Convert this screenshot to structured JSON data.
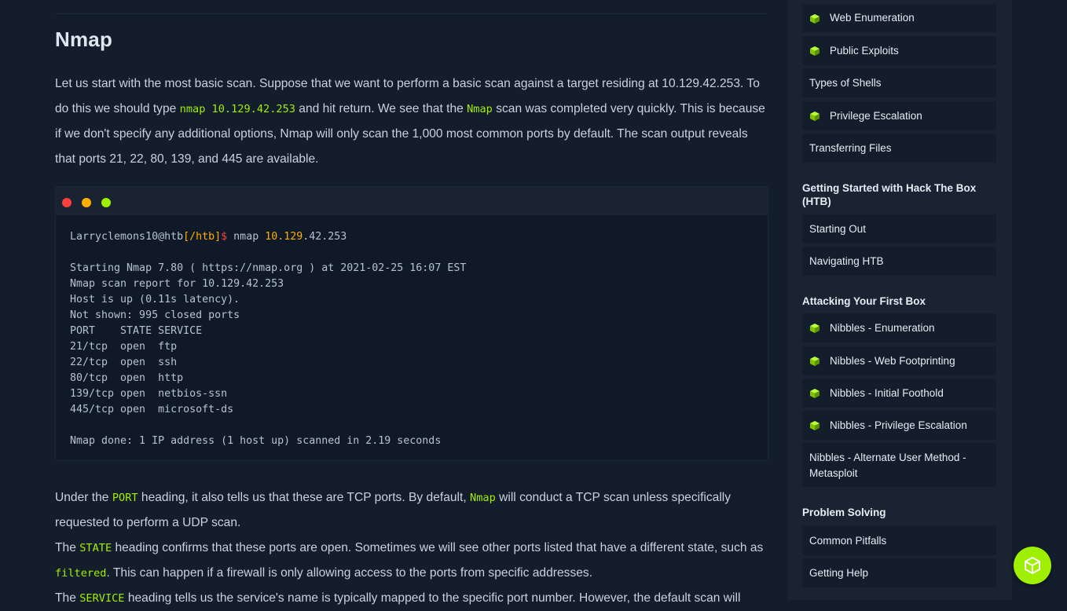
{
  "article": {
    "heading": "Nmap",
    "p1": {
      "t1": "Let us start with the most basic scan. Suppose that we want to perform a basic scan against a target residing at 10.129.42.253. To do this we should type ",
      "code1": "nmap 10.129.42.253",
      "t2": " and hit return. We see that the ",
      "code2": "Nmap",
      "t3": " scan was completed very quickly. This is because if we don't specify any additional options, Nmap will only scan the 1,000 most common ports by default. The scan output reveals that ports 21, 22, 80, 139, and 445 are available."
    },
    "terminal": {
      "prompt_user": "Larryclemons10@htb",
      "prompt_path": "[/htb]",
      "prompt_symbol": "$",
      "command_pre": " nmap ",
      "cmd_ip_a": "10.129",
      "cmd_ip_b": ".42.253",
      "output": [
        "Starting Nmap 7.80 ( https://nmap.org ) at 2021-02-25 16:07 EST",
        "Nmap scan report for 10.129.42.253",
        "Host is up (0.11s latency).",
        "Not shown: 995 closed ports",
        "PORT    STATE SERVICE",
        "21/tcp  open  ftp",
        "22/tcp  open  ssh",
        "80/tcp  open  http",
        "139/tcp open  netbios-ssn",
        "445/tcp open  microsoft-ds",
        "",
        "Nmap done: 1 IP address (1 host up) scanned in 2.19 seconds"
      ]
    },
    "p2": {
      "t1": "Under the ",
      "code1": "PORT",
      "t2": " heading, it also tells us that these are TCP ports. By default, ",
      "code2": "Nmap",
      "t3": " will conduct a TCP scan unless specifically requested to perform a UDP scan."
    },
    "p3": {
      "t1": "The ",
      "code1": "STATE",
      "t2": " heading confirms that these ports are open. Sometimes we will see other ports listed that have a different state, such as ",
      "code2": "filtered",
      "t3": ". This can happen if a firewall is only allowing access to the ports from specific addresses."
    },
    "p4": {
      "t1": "The ",
      "code1": "SERVICE",
      "t2": " heading tells us the service's name is typically mapped to the specific port number. However, the default scan will"
    }
  },
  "sidebar": {
    "items_top": [
      {
        "label": "Web Enumeration",
        "icon": "cube-icon"
      },
      {
        "label": "Public Exploits",
        "icon": "cube-icon"
      },
      {
        "label": "Types of Shells",
        "icon": ""
      },
      {
        "label": "Privilege Escalation",
        "icon": "cube-icon"
      },
      {
        "label": "Transferring Files",
        "icon": ""
      }
    ],
    "section_htb": "Getting Started with Hack The Box (HTB)",
    "items_htb": [
      {
        "label": "Starting Out"
      },
      {
        "label": "Navigating HTB"
      }
    ],
    "section_first_box": "Attacking Your First Box",
    "items_first_box": [
      {
        "label": "Nibbles - Enumeration",
        "icon": "cube-icon"
      },
      {
        "label": "Nibbles - Web Footprinting",
        "icon": "cube-icon"
      },
      {
        "label": "Nibbles - Initial Foothold",
        "icon": "cube-icon"
      },
      {
        "label": "Nibbles - Privilege Escalation",
        "icon": "cube-icon"
      },
      {
        "label": "Nibbles - Alternate User Method - Metasploit",
        "icon": ""
      }
    ],
    "section_problem": "Problem Solving",
    "items_problem": [
      {
        "label": "Common Pitfalls"
      },
      {
        "label": "Getting Help"
      }
    ]
  },
  "colors": {
    "accent": "#9fef00",
    "background": "#141d2b",
    "sidebar": "#1a2332",
    "orange": "#ffaf00",
    "red": "#ff3e3e"
  }
}
